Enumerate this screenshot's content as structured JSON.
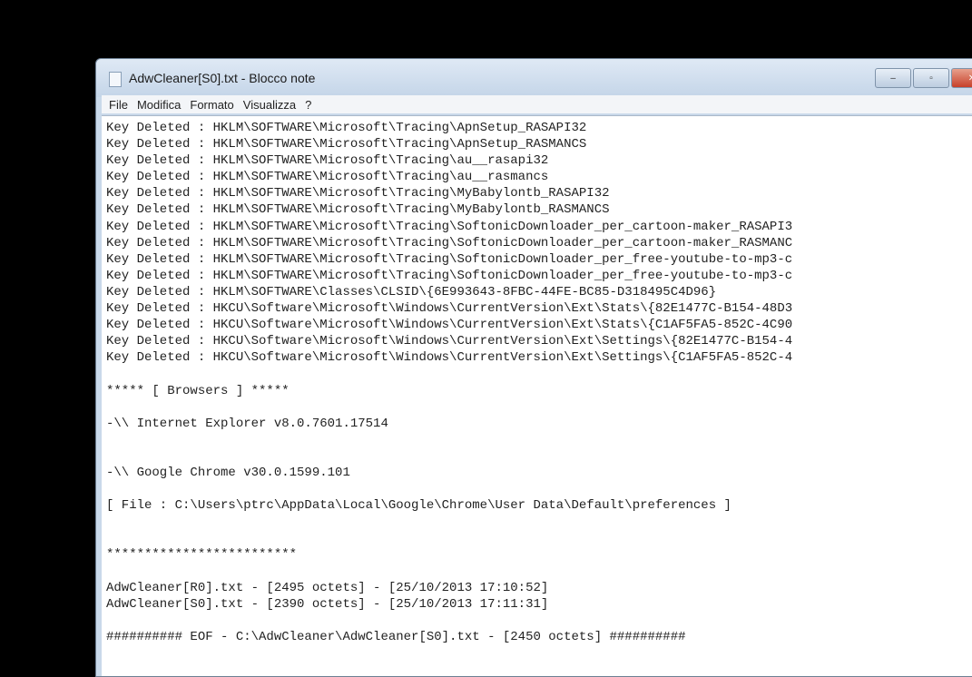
{
  "window": {
    "title": "AdwCleaner[S0].txt - Blocco note",
    "minimize": "–",
    "maximize": "▫",
    "close": "✕"
  },
  "menu": [
    "File",
    "Modifica",
    "Formato",
    "Visualizza",
    "?"
  ],
  "lines": [
    "Key Deleted : HKLM\\SOFTWARE\\Microsoft\\Tracing\\ApnSetup_RASAPI32",
    "Key Deleted : HKLM\\SOFTWARE\\Microsoft\\Tracing\\ApnSetup_RASMANCS",
    "Key Deleted : HKLM\\SOFTWARE\\Microsoft\\Tracing\\au__rasapi32",
    "Key Deleted : HKLM\\SOFTWARE\\Microsoft\\Tracing\\au__rasmancs",
    "Key Deleted : HKLM\\SOFTWARE\\Microsoft\\Tracing\\MyBabylontb_RASAPI32",
    "Key Deleted : HKLM\\SOFTWARE\\Microsoft\\Tracing\\MyBabylontb_RASMANCS",
    "Key Deleted : HKLM\\SOFTWARE\\Microsoft\\Tracing\\SoftonicDownloader_per_cartoon-maker_RASAPI3",
    "Key Deleted : HKLM\\SOFTWARE\\Microsoft\\Tracing\\SoftonicDownloader_per_cartoon-maker_RASMANC",
    "Key Deleted : HKLM\\SOFTWARE\\Microsoft\\Tracing\\SoftonicDownloader_per_free-youtube-to-mp3-c",
    "Key Deleted : HKLM\\SOFTWARE\\Microsoft\\Tracing\\SoftonicDownloader_per_free-youtube-to-mp3-c",
    "Key Deleted : HKLM\\SOFTWARE\\Classes\\CLSID\\{6E993643-8FBC-44FE-BC85-D318495C4D96}",
    "Key Deleted : HKCU\\Software\\Microsoft\\Windows\\CurrentVersion\\Ext\\Stats\\{82E1477C-B154-48D3",
    "Key Deleted : HKCU\\Software\\Microsoft\\Windows\\CurrentVersion\\Ext\\Stats\\{C1AF5FA5-852C-4C90",
    "Key Deleted : HKCU\\Software\\Microsoft\\Windows\\CurrentVersion\\Ext\\Settings\\{82E1477C-B154-4",
    "Key Deleted : HKCU\\Software\\Microsoft\\Windows\\CurrentVersion\\Ext\\Settings\\{C1AF5FA5-852C-4",
    "",
    "***** [ Browsers ] *****",
    "",
    "-\\\\ Internet Explorer v8.0.7601.17514",
    "",
    "",
    "-\\\\ Google Chrome v30.0.1599.101",
    "",
    "[ File : C:\\Users\\ptrc\\AppData\\Local\\Google\\Chrome\\User Data\\Default\\preferences ]",
    "",
    "",
    "*************************",
    "",
    "AdwCleaner[R0].txt - [2495 octets] - [25/10/2013 17:10:52]",
    "AdwCleaner[S0].txt - [2390 octets] - [25/10/2013 17:11:31]",
    "",
    "########## EOF - C:\\AdwCleaner\\AdwCleaner[S0].txt - [2450 octets] ##########"
  ]
}
